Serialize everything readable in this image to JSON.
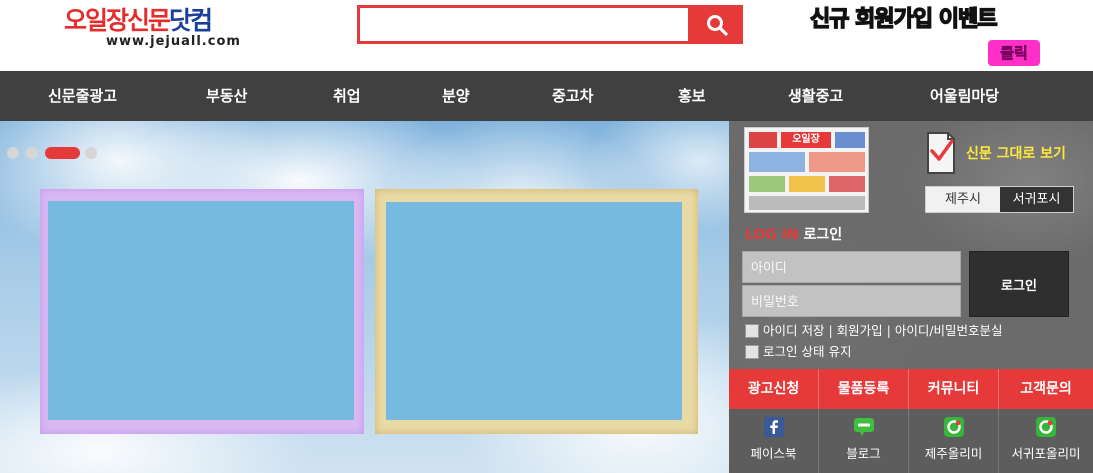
{
  "header": {
    "logo": {
      "main_red": "오일장신문",
      "main_blue": "닷컴",
      "url": "www.jejuall.com"
    },
    "search": {
      "placeholder": "",
      "value": ""
    },
    "event": {
      "text_white": "신규 회원가입 ",
      "text_yellow": "이벤트",
      "click_label": "클릭"
    }
  },
  "nav": {
    "items": [
      "신문줄광고",
      "부동산",
      "취업",
      "분양",
      "중고차",
      "홍보",
      "생활중고",
      "어울림마당"
    ]
  },
  "hero": {
    "slide_count": 4,
    "active_slide": 2
  },
  "sidebar": {
    "paper_thumb_title": "오일장",
    "paper_view_label": "신문 그대로 보기",
    "regions": {
      "jeju": "제주시",
      "seogwipo": "서귀포시",
      "selected": "서귀포시"
    },
    "login": {
      "title_en": "LOG IN",
      "title_ko": " 로그인",
      "id_placeholder": "아이디",
      "pw_placeholder": "비밀번호",
      "button_label": "로그인",
      "save_id_label": "아이디 저장",
      "join_label": "회원가입",
      "find_label": "아이디/비밀번호분실",
      "separator": " | ",
      "keep_login_label": "로그인 상태 유지"
    },
    "quick_menu": [
      "광고신청",
      "물품등록",
      "커뮤니티",
      "고객문의"
    ],
    "social": [
      {
        "label": "페이스북",
        "icon": "facebook-icon"
      },
      {
        "label": "블로그",
        "icon": "blog-icon"
      },
      {
        "label": "제주올리미",
        "icon": "olimi-icon"
      },
      {
        "label": "서귀포올리미",
        "icon": "olimi-icon"
      }
    ]
  },
  "colors": {
    "brand_red": "#e5393a",
    "nav_bg": "#404040",
    "logo_blue": "#1b3f9a",
    "event_yellow": "#ffe93a",
    "event_pink": "#ff2fc8"
  }
}
